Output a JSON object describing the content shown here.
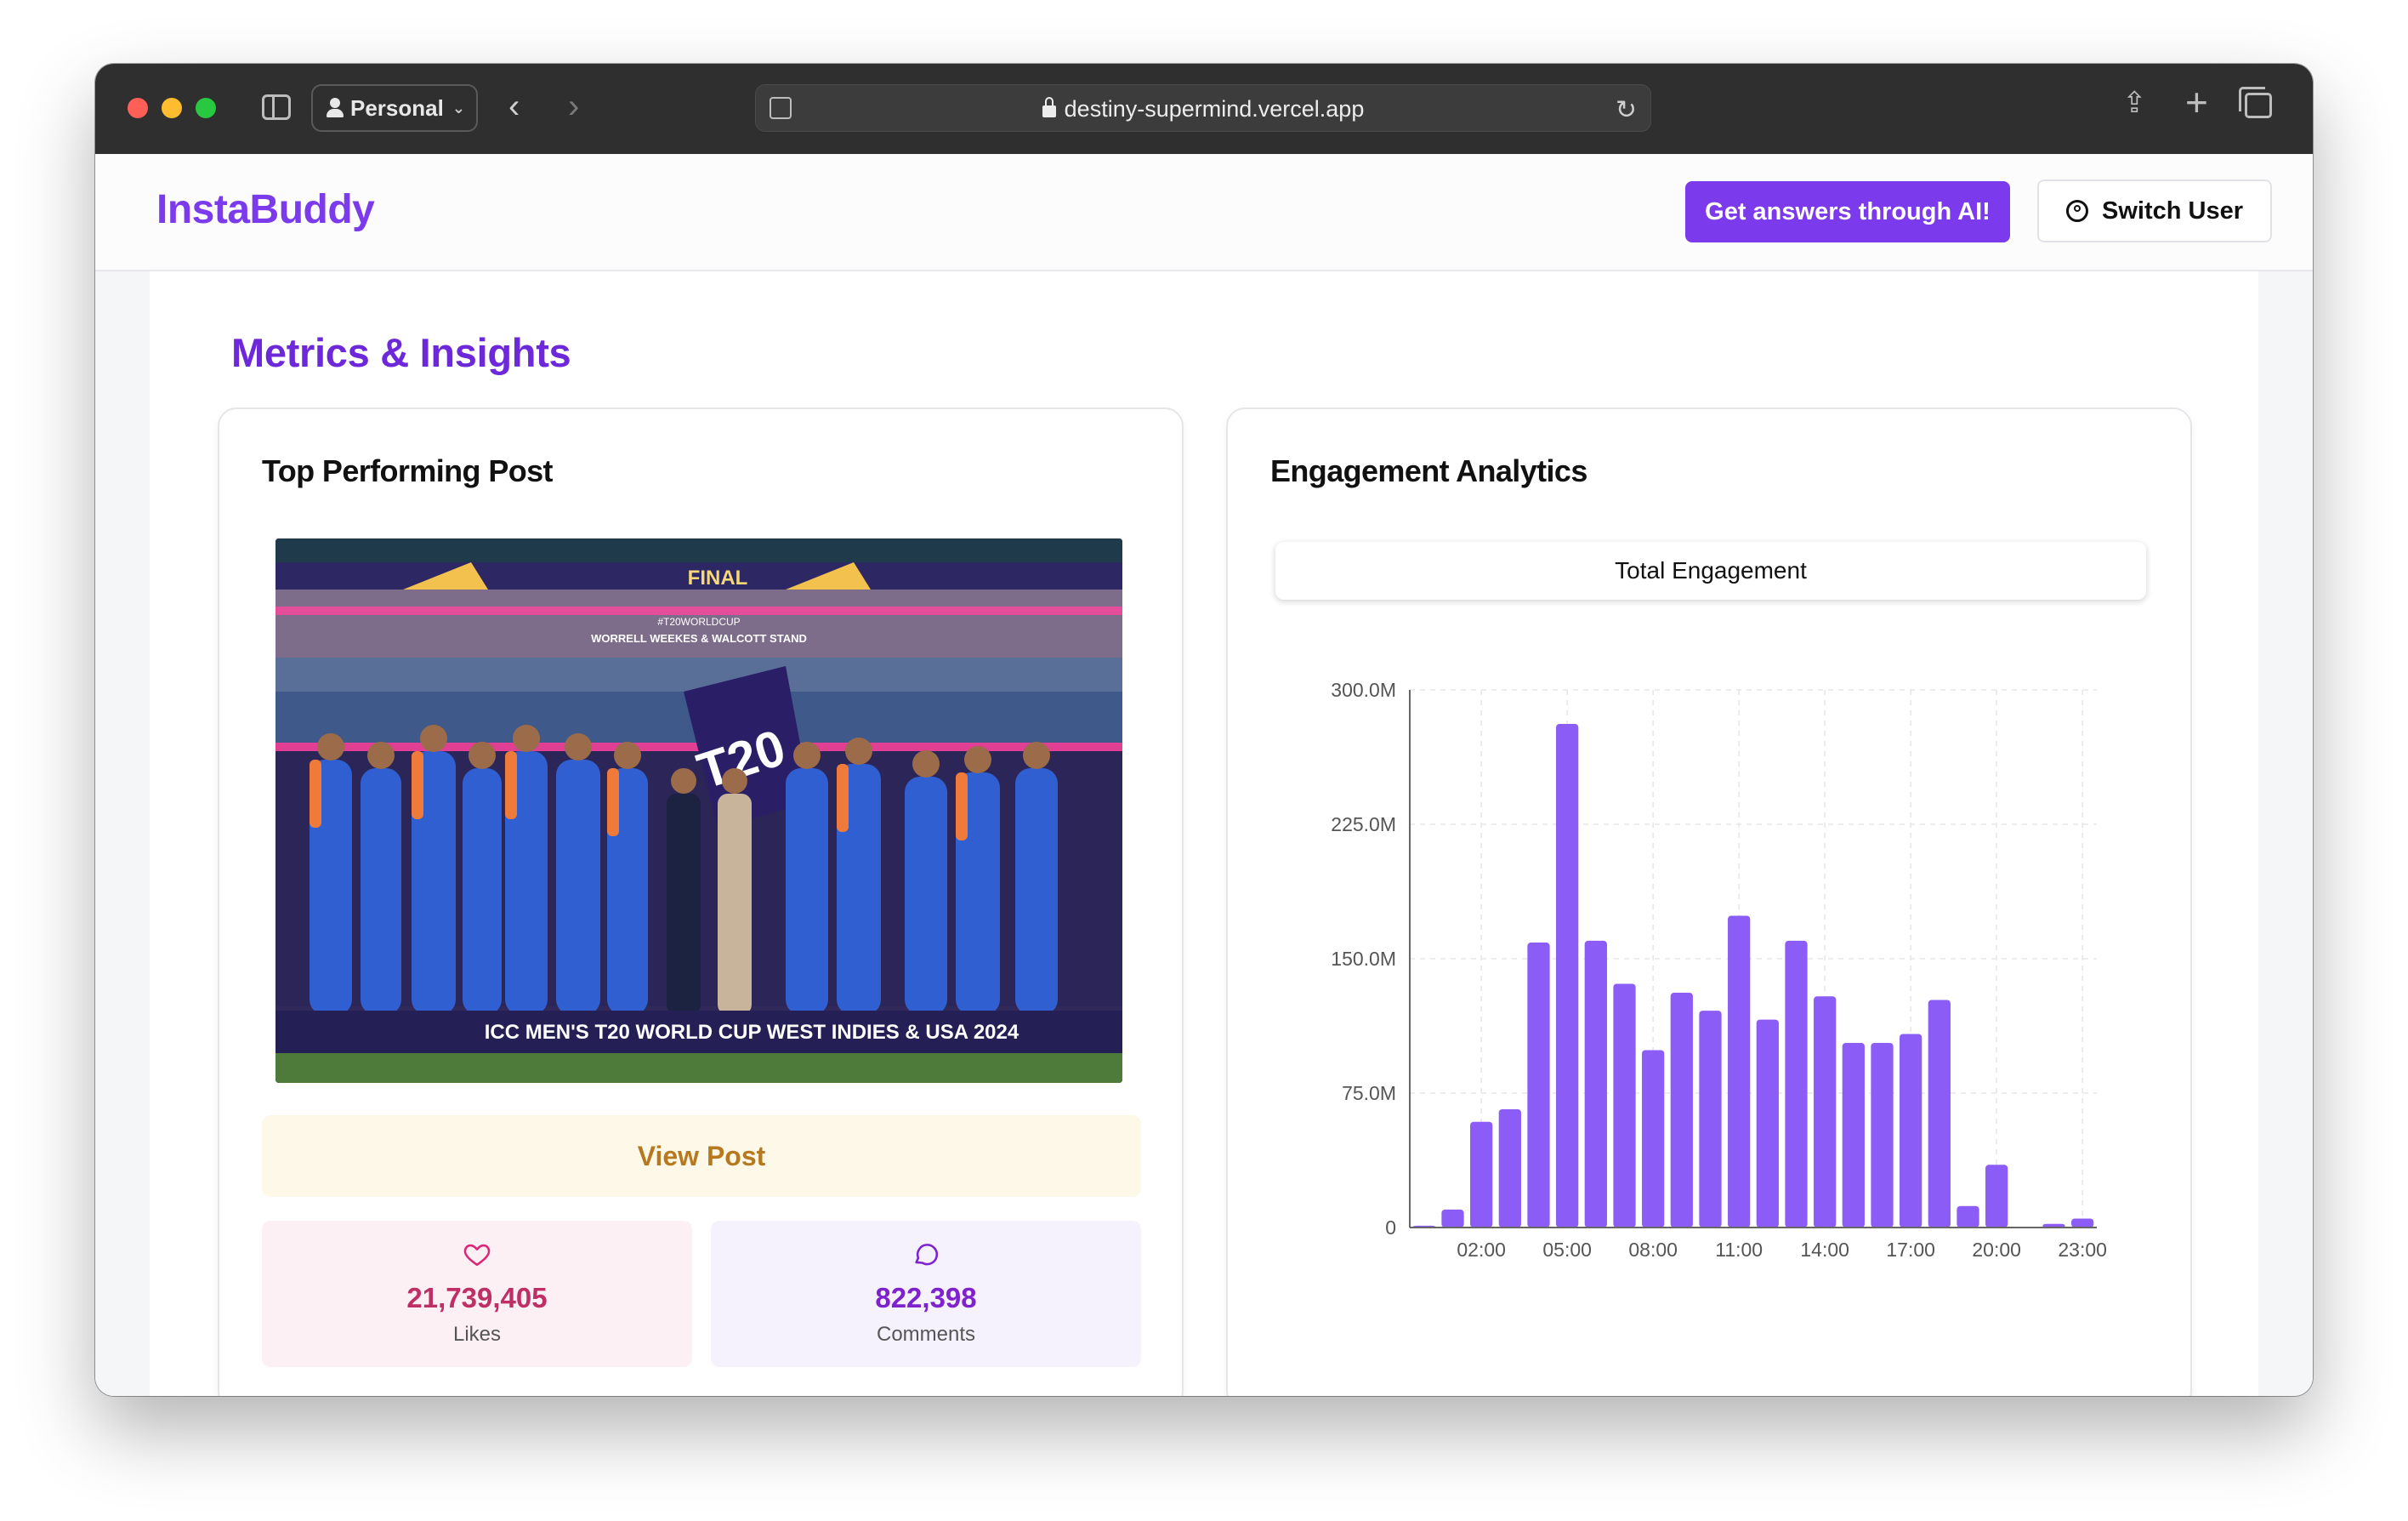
{
  "browser": {
    "profile": "Personal",
    "url": "destiny-supermind.vercel.app"
  },
  "header": {
    "brand": "InstaBuddy",
    "ai_button": "Get answers through AI!",
    "switch_user": "Switch User"
  },
  "page": {
    "section_title": "Metrics & Insights"
  },
  "top_post": {
    "title": "Top Performing Post",
    "image_caption": "ICC MEN'S T20 WORLD CUP WEST INDIES & USA 2024",
    "image_banner": "FINAL",
    "image_stand": "WORRELL WEEKES & WALCOTT STAND",
    "image_hashtag": "#T20WORLDCUP",
    "view_button": "View Post",
    "likes_value": "21,739,405",
    "likes_label": "Likes",
    "comments_value": "822,398",
    "comments_label": "Comments"
  },
  "engagement": {
    "title": "Engagement Analytics",
    "tab_label": "Total Engagement"
  },
  "chart_data": {
    "type": "bar",
    "title": "",
    "xlabel": "",
    "ylabel": "",
    "categories": [
      "00:00",
      "01:00",
      "02:00",
      "03:00",
      "04:00",
      "05:00",
      "06:00",
      "07:00",
      "08:00",
      "09:00",
      "10:00",
      "11:00",
      "12:00",
      "13:00",
      "14:00",
      "15:00",
      "16:00",
      "17:00",
      "18:00",
      "19:00",
      "20:00",
      "21:00",
      "22:00",
      "23:00"
    ],
    "values": [
      1,
      10,
      59,
      66,
      159,
      281,
      160,
      136,
      99,
      131,
      121,
      174,
      116,
      160,
      129,
      103,
      103,
      108,
      127,
      12,
      35,
      0,
      2,
      5
    ],
    "value_unit": "M",
    "x_tick_labels": [
      "02:00",
      "05:00",
      "08:00",
      "11:00",
      "14:00",
      "17:00",
      "20:00",
      "23:00"
    ],
    "y_tick_labels": [
      "0",
      "75.0M",
      "150.0M",
      "225.0M",
      "300.0M"
    ],
    "ylim": [
      0,
      300
    ],
    "grid": true,
    "bar_color": "#8b5cf6"
  }
}
